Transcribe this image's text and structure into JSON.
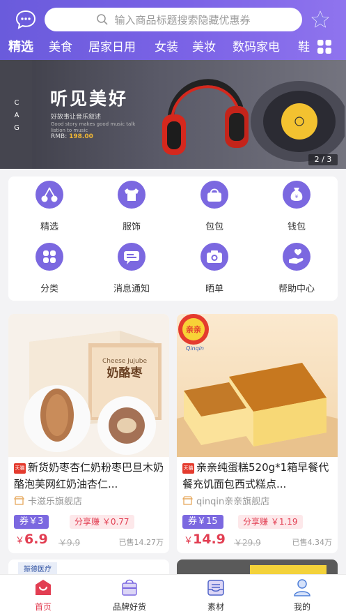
{
  "search": {
    "placeholder": "输入商品标题搜索隐藏优惠券"
  },
  "categories": [
    "精选",
    "美食",
    "居家日用",
    "女装",
    "美妆",
    "数码家电",
    "鞋"
  ],
  "banner": {
    "side_text": "C A G",
    "title": "听见美好",
    "subtitle": "好故事让音乐叙述",
    "subtitle_en": "Good story makes good music talk listion to music",
    "price_label": "RMB:",
    "price_value": "198.00",
    "indicator": "2 / 3"
  },
  "menu": [
    {
      "label": "精选",
      "icon": "cherry-icon"
    },
    {
      "label": "服饰",
      "icon": "tshirt-icon"
    },
    {
      "label": "包包",
      "icon": "bag-icon"
    },
    {
      "label": "钱包",
      "icon": "money-bag-icon"
    },
    {
      "label": "分类",
      "icon": "category-icon"
    },
    {
      "label": "消息通知",
      "icon": "message-icon"
    },
    {
      "label": "晒单",
      "icon": "camera-icon"
    },
    {
      "label": "帮助中心",
      "icon": "heart-hand-icon"
    }
  ],
  "products": [
    {
      "badge": "天猫",
      "title": "新货奶枣杏仁奶粉枣巴旦木奶酪泡芙网红奶油杏仁...",
      "shop": "卡滋乐旗舰店",
      "coupon": "券￥3",
      "share": "分享赚 ￥0.77",
      "currency": "￥",
      "price": "6.9",
      "original_price": "￥9.9",
      "sold": "已售14.27万",
      "image_text": "奶酪枣",
      "image_text_en": "Cheese Jujube"
    },
    {
      "badge": "天猫",
      "title": "亲亲纯蛋糕520g*1箱早餐代餐充饥面包西式糕点...",
      "shop": "qinqin亲亲旗舰店",
      "coupon": "券￥15",
      "share": "分享赚 ￥1.19",
      "currency": "￥",
      "price": "14.9",
      "original_price": "￥29.9",
      "sold": "已售4.34万",
      "image_text": "亲亲",
      "image_text_en": "Qinqin"
    }
  ],
  "partial_cards": [
    {
      "label": "振德医疗"
    },
    {
      "label": ""
    }
  ],
  "tabbar": [
    {
      "label": "首页",
      "icon": "home-icon",
      "active": true
    },
    {
      "label": "品牌好货",
      "icon": "shopping-bag-icon",
      "active": false
    },
    {
      "label": "素材",
      "icon": "inbox-icon",
      "active": false
    },
    {
      "label": "我的",
      "icon": "user-icon",
      "active": false
    }
  ],
  "colors": {
    "brand": "#7163e0",
    "price": "#e23e52",
    "coupon": "#7b68e0"
  }
}
